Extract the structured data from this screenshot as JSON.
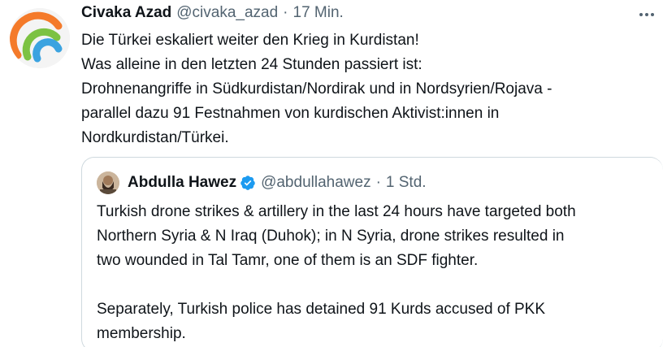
{
  "tweet": {
    "author_name": "Civaka Azad",
    "author_handle": "@civaka_azad",
    "separator": "·",
    "time": "17 Min.",
    "lines": [
      "Die Türkei eskaliert weiter den Krieg in Kurdistan!",
      "Was alleine in den letzten 24 Stunden passiert ist:",
      "Drohnenangriffe in Südkurdistan/Nordirak und in Nordsyrien/Rojava -",
      "parallel dazu 91 Festnahmen von kurdischen Aktivist:innen in",
      "Nordkurdistan/Türkei."
    ],
    "more_icon": "more-horizontal-icon"
  },
  "quote": {
    "author_name": "Abdulla Hawez",
    "author_handle": "@abdullahawez",
    "separator": "·",
    "time": "1 Std.",
    "verified_icon": "verified-badge-icon",
    "verified_color": "#1d9bf0",
    "paragraph1": [
      "Turkish drone strikes & artillery in the last 24 hours have targeted both",
      "Northern Syria & N Iraq (Duhok); in N Syria, drone strikes resulted in",
      "two wounded in Tal Tamr, one of them is an SDF fighter."
    ],
    "paragraph2": [
      "Separately, Turkish police has detained 91 Kurds accused of PKK",
      "membership."
    ]
  },
  "colors": {
    "text_primary": "#0f1419",
    "text_secondary": "#536471",
    "border": "#cfd9de",
    "logo_orange": "#f47a2a",
    "logo_green": "#7cc242",
    "logo_blue": "#3ba3e0"
  }
}
